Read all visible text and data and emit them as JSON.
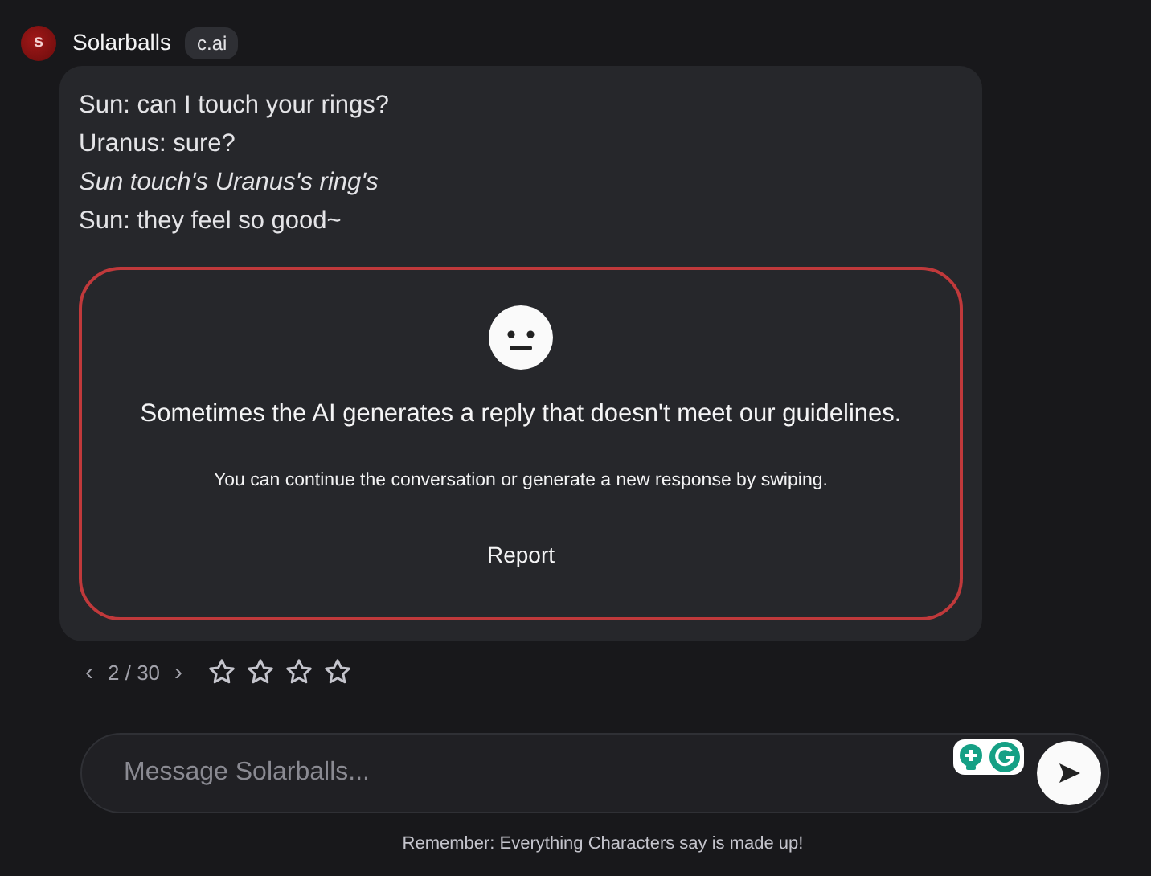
{
  "character": {
    "avatar_letter": "s",
    "name": "Solarballs",
    "badge": "c.ai"
  },
  "message": {
    "lines": [
      {
        "kind": "plain",
        "text": "Sun: can I touch your rings?"
      },
      {
        "kind": "plain",
        "text": "Uranus: sure?"
      },
      {
        "kind": "action",
        "text": "Sun touch's Uranus's ring's"
      },
      {
        "kind": "plain",
        "text": "Sun: they feel so good~"
      }
    ],
    "warning": {
      "title": "Sometimes the AI generates a reply that doesn't meet our guidelines.",
      "detail": "You can continue the conversation or generate a new response by swiping.",
      "action": "Report"
    }
  },
  "pager": {
    "prev": "‹",
    "count": "2 / 30",
    "next": "›"
  },
  "rating": {
    "stars": 0
  },
  "composer": {
    "placeholder": "Message Solarballs..."
  },
  "disclaimer": "Remember: Everything Characters say is made up!"
}
